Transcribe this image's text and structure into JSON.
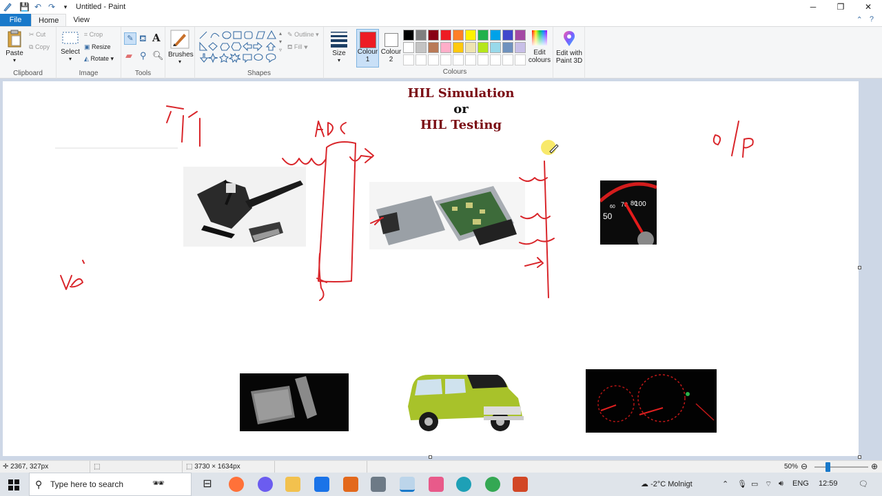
{
  "window": {
    "title": "Untitled - Paint",
    "controls": [
      "─",
      "❐",
      "✕"
    ]
  },
  "tabs": {
    "file": "File",
    "home": "Home",
    "view": "View"
  },
  "ribbon": {
    "clipboard": {
      "label": "Clipboard",
      "paste": "Paste",
      "cut": "Cut",
      "copy": "Copy"
    },
    "image": {
      "label": "Image",
      "select": "Select",
      "crop": "Crop",
      "resize": "Resize",
      "rotate": "Rotate"
    },
    "tools": {
      "label": "Tools"
    },
    "brushes": {
      "label": "Brushes"
    },
    "shapes": {
      "label": "Shapes",
      "outline": "Outline",
      "fill": "Fill"
    },
    "size": {
      "label": "Size"
    },
    "colour1": {
      "line1": "Colour",
      "line2": "1",
      "color": "#ed1c24"
    },
    "colour2": {
      "line1": "Colour",
      "line2": "2",
      "color": "#ffffff"
    },
    "colours": {
      "label": "Colours"
    },
    "edit_colours": {
      "line1": "Edit",
      "line2": "colours"
    },
    "paint3d": {
      "line1": "Edit with",
      "line2": "Paint 3D"
    }
  },
  "palette": {
    "row1": [
      "#000000",
      "#7f7f7f",
      "#880015",
      "#ed1c24",
      "#ff7f27",
      "#fff200",
      "#22b14c",
      "#00a2e8",
      "#3f48cc",
      "#a349a4"
    ],
    "row2": [
      "#ffffff",
      "#c3c3c3",
      "#b97a57",
      "#ffaec9",
      "#ffc90e",
      "#efe4b0",
      "#b5e61d",
      "#99d9ea",
      "#7092be",
      "#c8bfe7"
    ],
    "row3": [
      "#ffffff",
      "#ffffff",
      "#ffffff",
      "#ffffff",
      "#ffffff",
      "#ffffff",
      "#ffffff",
      "#ffffff",
      "#ffffff",
      "#ffffff"
    ]
  },
  "canvas": {
    "title_line1": "HIL Simulation",
    "title_line2": "or",
    "title_line3": "HIL Testing",
    "handwriting": {
      "ip": "I/I",
      "adc": "ADC",
      "op": "O/P"
    },
    "ink_color": "#d9262b"
  },
  "statusbar": {
    "cursor_pos": "2367, 327px",
    "dimensions": "3730 × 1634px",
    "zoom": "50%"
  },
  "taskbar": {
    "search_placeholder": "Type here to search",
    "weather": "-2°C  Molnigt",
    "lang": "ENG",
    "time": "12:59"
  }
}
